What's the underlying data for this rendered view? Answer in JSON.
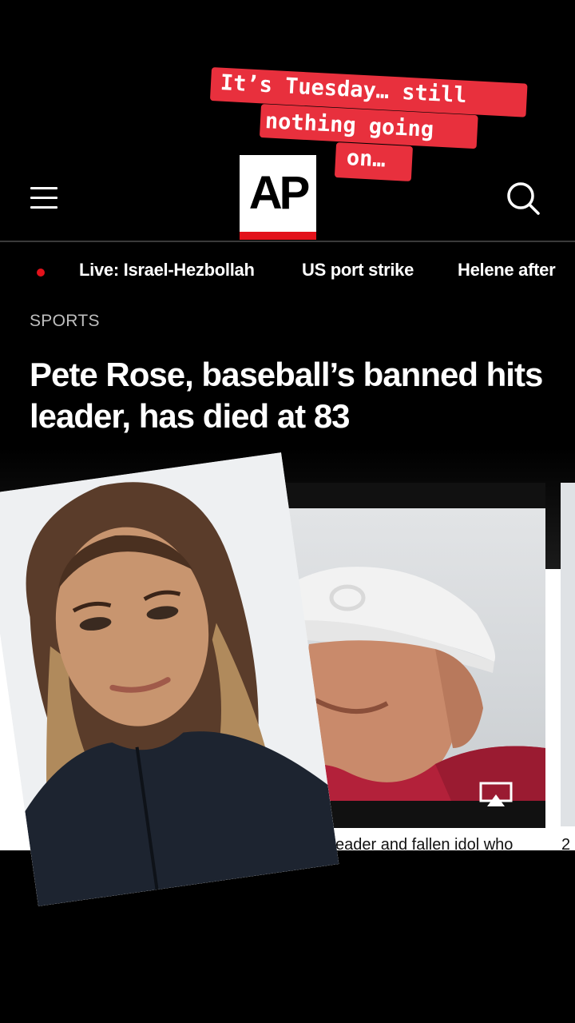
{
  "overlay": {
    "lines": [
      "It’s Tuesday… still",
      "nothing going",
      "on…"
    ]
  },
  "header": {
    "logo_text": "AP"
  },
  "topics": [
    "Live: Israel-Hezbollah",
    "US port strike",
    "Helene after"
  ],
  "article": {
    "section": "SPORTS",
    "headline": "Pete Rose, baseball’s banned hits leader, has died at 83",
    "caption": "s leader and fallen idol who",
    "caption_next": "2"
  },
  "colors": {
    "accent": "#e3121b",
    "sticker": "#e8303d",
    "background": "#000000"
  },
  "icons": [
    "menu-icon",
    "search-icon",
    "live-dot-icon",
    "cast-icon"
  ]
}
